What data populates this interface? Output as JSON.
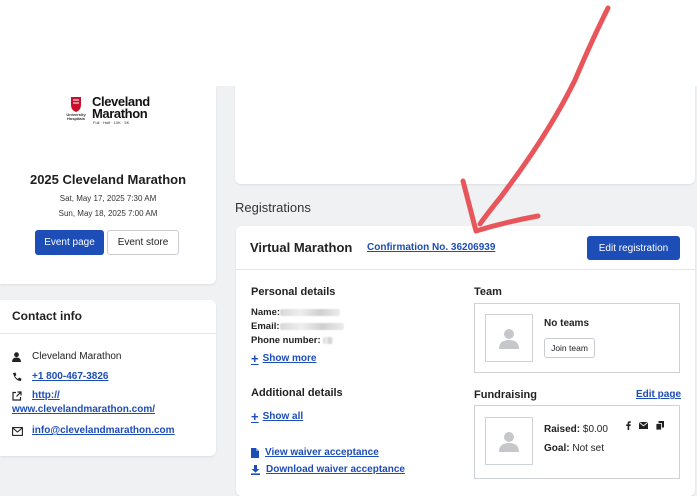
{
  "event": {
    "logo": {
      "brand_line1": "Cleveland",
      "brand_line2": "Marathon",
      "sponsor": "University Hospitals",
      "tagline": "Full · Half · 10K · 5K"
    },
    "title": "2025 Cleveland Marathon",
    "dates": [
      "Sat, May 17, 2025 7:30 AM",
      "Sun, May 18, 2025 7:00 AM"
    ],
    "event_page_label": "Event page",
    "event_store_label": "Event store"
  },
  "contact": {
    "title": "Contact info",
    "name": "Cleveland Marathon",
    "phone": "+1 800-467-3826",
    "website_line1": "http://",
    "website_line2": "www.clevelandmarathon.com/",
    "email": "info@clevelandmarathon.com"
  },
  "registrations": {
    "section_title": "Registrations",
    "race": "Virtual Marathon",
    "confirmation": "Confirmation No. 36206939",
    "edit_registration_label": "Edit registration",
    "personal": {
      "title": "Personal details",
      "name_label": "Name:",
      "email_label": "Email:",
      "phone_label": "Phone number:",
      "show_more": "Show more"
    },
    "additional": {
      "title": "Additional details",
      "show_all": "Show all"
    },
    "waiver": {
      "view": "View waiver acceptance",
      "download": "Download waiver acceptance"
    },
    "team": {
      "title": "Team",
      "status": "No teams",
      "join_label": "Join team"
    },
    "fundraising": {
      "title": "Fundraising",
      "edit_page": "Edit page",
      "raised_label": "Raised:",
      "raised_value": "$0.00",
      "goal_label": "Goal:",
      "goal_value": "Not set"
    }
  },
  "colors": {
    "primary": "#1d4db7",
    "annotation_arrow": "#e8555a",
    "page_bg": "#f0f1f3"
  }
}
